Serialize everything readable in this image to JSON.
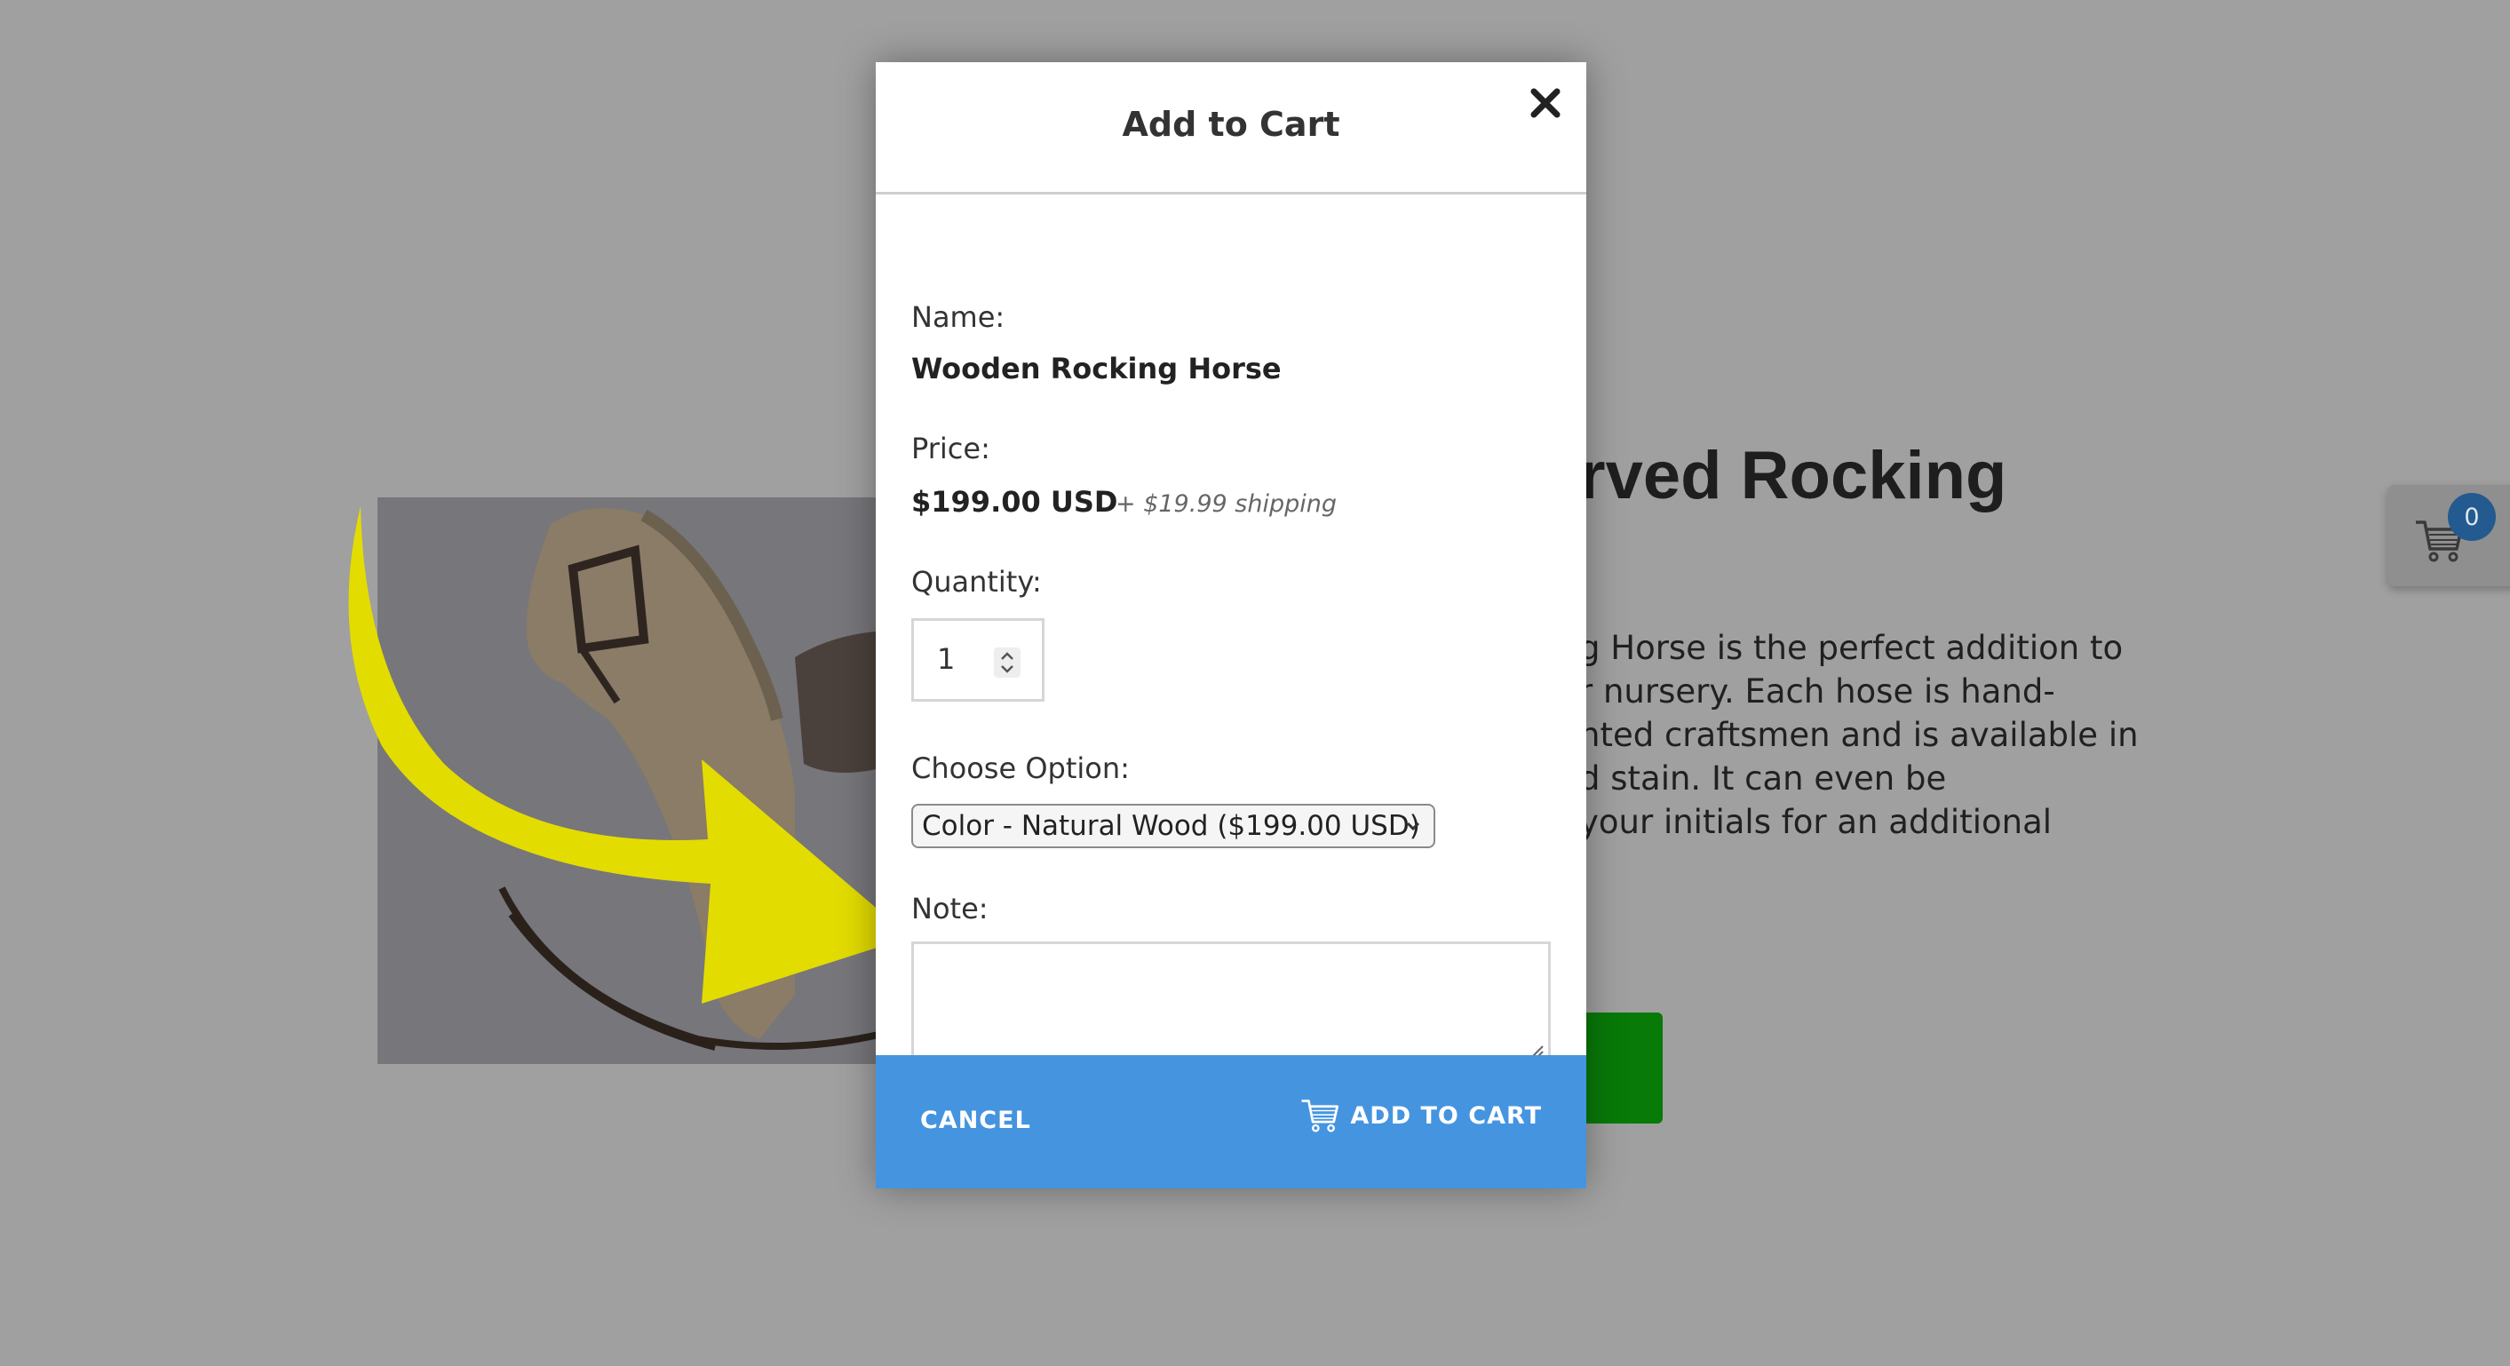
{
  "background": {
    "title_fragment": "rved Rocking",
    "description_lines": [
      "g Horse is the perfect addition to",
      "r nursery. Each hose is hand-",
      "nted craftsmen and is available in",
      "d stain. It can even be",
      "your initials for an additional"
    ],
    "cart_count": "0"
  },
  "modal": {
    "title": "Add to Cart",
    "name_label": "Name:",
    "name_value": "Wooden Rocking Horse",
    "price_label": "Price:",
    "price_value": "$199.00 USD",
    "shipping": "+ $19.99 shipping",
    "quantity_label": "Quantity:",
    "quantity_value": "1",
    "option_label": "Choose Option:",
    "option_selected": "Color - Natural Wood ($199.00 USD)",
    "note_label": "Note:",
    "note_value": "",
    "cancel_label": "CANCEL",
    "add_label": "ADD TO CART"
  },
  "icons": {
    "close": "close-icon",
    "cart": "shopping-cart-icon",
    "select": "chevron-down-icon",
    "resize": "resize-grip-icon"
  },
  "colors": {
    "overlay": "#a0a0a0",
    "footer": "#4594e0",
    "arrow": "#e3dc00",
    "buy_button": "#087a08",
    "badge": "#235a90"
  }
}
